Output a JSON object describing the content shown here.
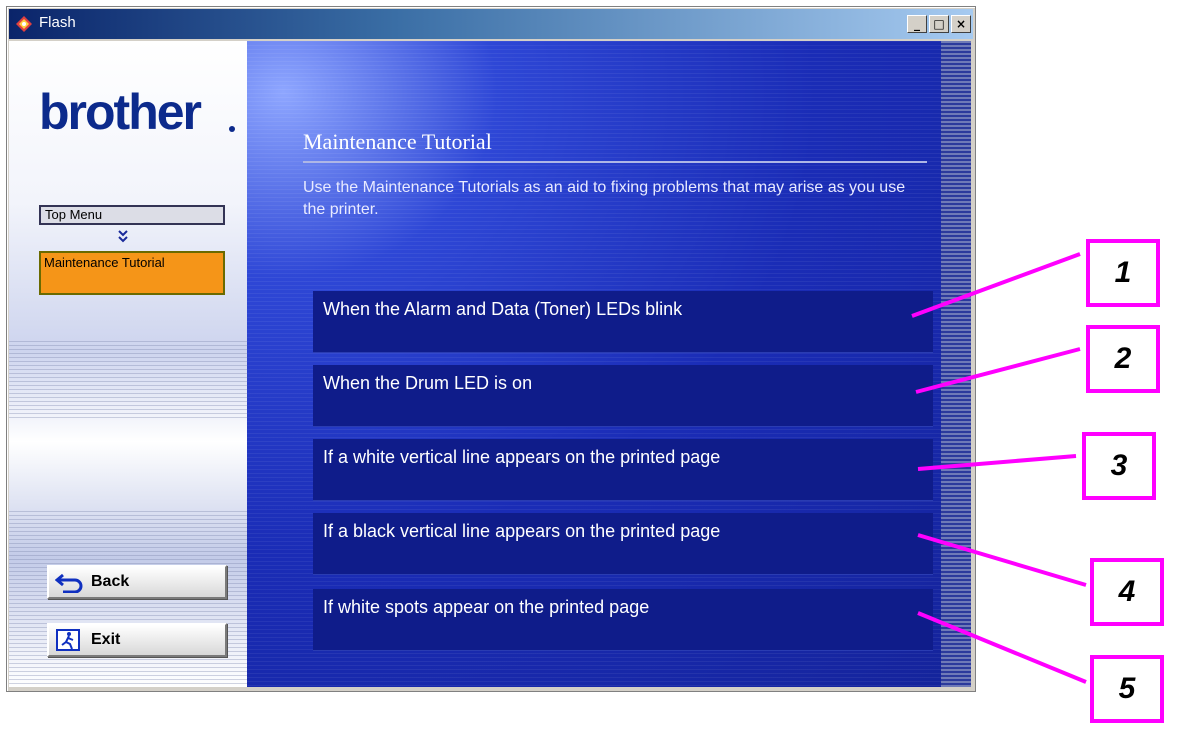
{
  "window": {
    "title": "Flash",
    "controls": {
      "minimize": "_",
      "maximize": "□",
      "close": "×"
    }
  },
  "sidebar": {
    "logo": "brother",
    "nav": {
      "top_menu": "Top Menu",
      "current": "Maintenance Tutorial"
    },
    "buttons": {
      "back": "Back",
      "exit": "Exit"
    }
  },
  "main": {
    "title": "Maintenance Tutorial",
    "description": "Use the Maintenance Tutorials as an aid to fixing problems that may arise as you use the printer.",
    "items": [
      "When the Alarm and Data (Toner) LEDs blink",
      "When the Drum LED is on",
      "If a white vertical line appears on the printed page",
      "If a black vertical line appears on the printed page",
      "If white spots appear on the printed page"
    ]
  },
  "callouts": [
    "1",
    "2",
    "3",
    "4",
    "5"
  ],
  "colors": {
    "accent": "#ff00ff",
    "main_bg": "#1a2cb6",
    "item_bg": "#0f1c8a",
    "current_nav": "#f59518",
    "logo": "#0c2a8c"
  },
  "icons": {
    "window": "flash-icon",
    "back": "back-arrow-icon",
    "exit": "exit-icon",
    "nav_arrow": "double-chevron-down-icon"
  }
}
